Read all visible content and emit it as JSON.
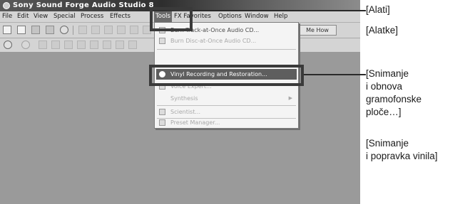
{
  "window": {
    "title": "Sony Sound Forge Audio Studio 8"
  },
  "menubar": {
    "items": [
      {
        "label": "File"
      },
      {
        "label": "Edit"
      },
      {
        "label": "View"
      },
      {
        "label": "Special"
      },
      {
        "label": "Process"
      },
      {
        "label": "Effects"
      },
      {
        "label": "Tools"
      },
      {
        "label": "FX Favorites"
      },
      {
        "label": "Options"
      },
      {
        "label": "Window"
      },
      {
        "label": "Help"
      }
    ]
  },
  "toolbar": {
    "right_button_label": "Me How"
  },
  "tools_menu": {
    "items": [
      {
        "label": "Burn Track-at-Once Audio CD..."
      },
      {
        "label": "Burn Disc-at-Once Audio CD..."
      },
      {
        "label": "Vinyl Recording and Restoration..."
      },
      {
        "label": "Voice Expert..."
      },
      {
        "label": "Synthesis"
      },
      {
        "label": "Scientist..."
      },
      {
        "label": "Preset Manager..."
      }
    ]
  },
  "annotations": {
    "tools_hr": "[Alati]",
    "tools_bs": "[Alatke]",
    "vinyl_hr": "[Snimanje\ni obnova\ngramofonske\nploče…]",
    "vinyl_bs": "[Snimanje\ni popravka vinila]"
  }
}
